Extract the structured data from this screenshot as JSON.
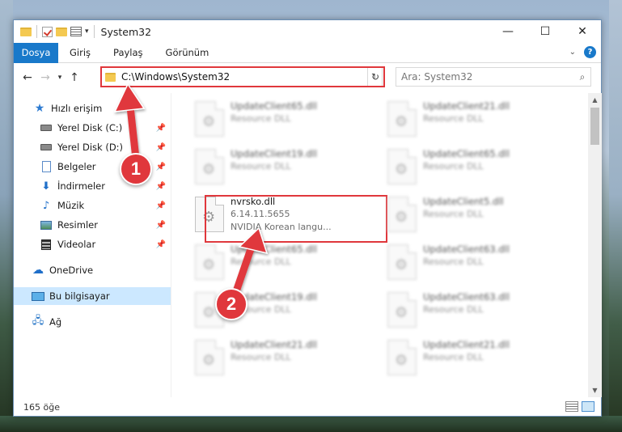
{
  "window": {
    "title": "System32",
    "controls": {
      "minimize": "—",
      "maximize": "☐",
      "close": "✕"
    }
  },
  "ribbon": {
    "tabs": [
      "Dosya",
      "Giriş",
      "Paylaş",
      "Görünüm"
    ]
  },
  "address": {
    "path": "C:\\Windows\\System32"
  },
  "search": {
    "placeholder": "Ara: System32"
  },
  "sidebar": {
    "items": [
      {
        "label": "Hızlı erişim",
        "icon": "star-icon"
      },
      {
        "label": "Yerel Disk (C:)",
        "icon": "drive-icon",
        "pinned": true
      },
      {
        "label": "Yerel Disk (D:)",
        "icon": "drive-icon",
        "pinned": true
      },
      {
        "label": "Belgeler",
        "icon": "documents-icon",
        "pinned": true
      },
      {
        "label": "İndirmeler",
        "icon": "downloads-icon",
        "pinned": true
      },
      {
        "label": "Müzik",
        "icon": "music-icon",
        "pinned": true
      },
      {
        "label": "Resimler",
        "icon": "pictures-icon",
        "pinned": true
      },
      {
        "label": "Videolar",
        "icon": "videos-icon",
        "pinned": true
      },
      {
        "label": "OneDrive",
        "icon": "cloud-icon"
      },
      {
        "label": "Bu bilgisayar",
        "icon": "computer-icon",
        "selected": true
      },
      {
        "label": "Ağ",
        "icon": "network-icon"
      }
    ]
  },
  "files": {
    "left": [
      {
        "name": "UpdateClient65.dll",
        "sub": "Resource DLL",
        "blurred": true
      },
      {
        "name": "UpdateClient19.dll",
        "sub": "Resource DLL",
        "blurred": true
      },
      {
        "name": "nvrsko.dll",
        "sub": "6.14.11.5655",
        "sub2": "NVIDIA Korean langu...",
        "blurred": false
      },
      {
        "name": "UpdateClient65.dll",
        "sub": "Resource DLL",
        "blurred": true
      },
      {
        "name": "UpdateClient19.dll",
        "sub": "Resource DLL",
        "blurred": true
      },
      {
        "name": "UpdateClient21.dll",
        "sub": "Resource DLL",
        "blurred": true
      }
    ],
    "right": [
      {
        "name": "UpdateClient21.dll",
        "sub": "Resource DLL"
      },
      {
        "name": "UpdateClient65.dll",
        "sub": "Resource DLL"
      },
      {
        "name": "UpdateClient5.dll",
        "sub": "Resource DLL"
      },
      {
        "name": "UpdateClient63.dll",
        "sub": "Resource DLL"
      },
      {
        "name": "UpdateClient63.dll",
        "sub": "Resource DLL"
      },
      {
        "name": "UpdateClient21.dll",
        "sub": "Resource DLL"
      }
    ]
  },
  "status": {
    "count": "165 öğe"
  },
  "annotations": {
    "badge1": "1",
    "badge2": "2",
    "color": "#e0373c"
  }
}
